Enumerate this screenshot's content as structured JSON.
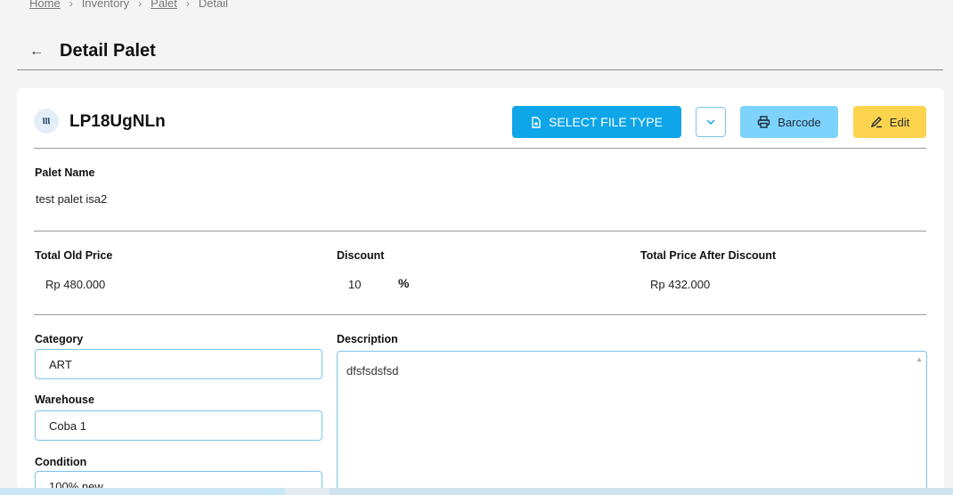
{
  "breadcrumb": {
    "home": "Home",
    "sep": "›",
    "inventory": "Inventory",
    "palet": "Palet",
    "detail": "Detail"
  },
  "header": {
    "back": "←",
    "title": "Detail Palet"
  },
  "card": {
    "code_icon": "ⲒⲒⲒ",
    "palet_code": "LP18UgNLn",
    "buttons": {
      "select_file_type": "SELECT FILE TYPE",
      "dropdown": "⌄",
      "barcode": "Barcode",
      "edit": "Edit"
    },
    "icons": {
      "select_file_type": "file-plus-icon",
      "barcode": "printer-icon",
      "edit": "pencil-icon"
    }
  },
  "fields": {
    "palet_name_label": "Palet Name",
    "palet_name_value": "test palet isa2",
    "total_old_price_label": "Total Old Price",
    "total_old_price_value": "Rp 480.000",
    "discount_label": "Discount",
    "discount_value": "10",
    "discount_unit": "%",
    "total_after_label": "Total Price After Discount",
    "total_after_value": "Rp 432.000",
    "category_label": "Category",
    "category_value": "ART",
    "warehouse_label": "Warehouse",
    "warehouse_value": "Coba 1",
    "condition_label": "Condition",
    "condition_value": "100% new",
    "description_label": "Description",
    "description_value": "dfsfsdsfsd"
  },
  "colors": {
    "primary": "#0ea5e9",
    "info_light": "#7dd3fc",
    "warning": "#fcd34d",
    "input_border": "#7cc3ea"
  }
}
